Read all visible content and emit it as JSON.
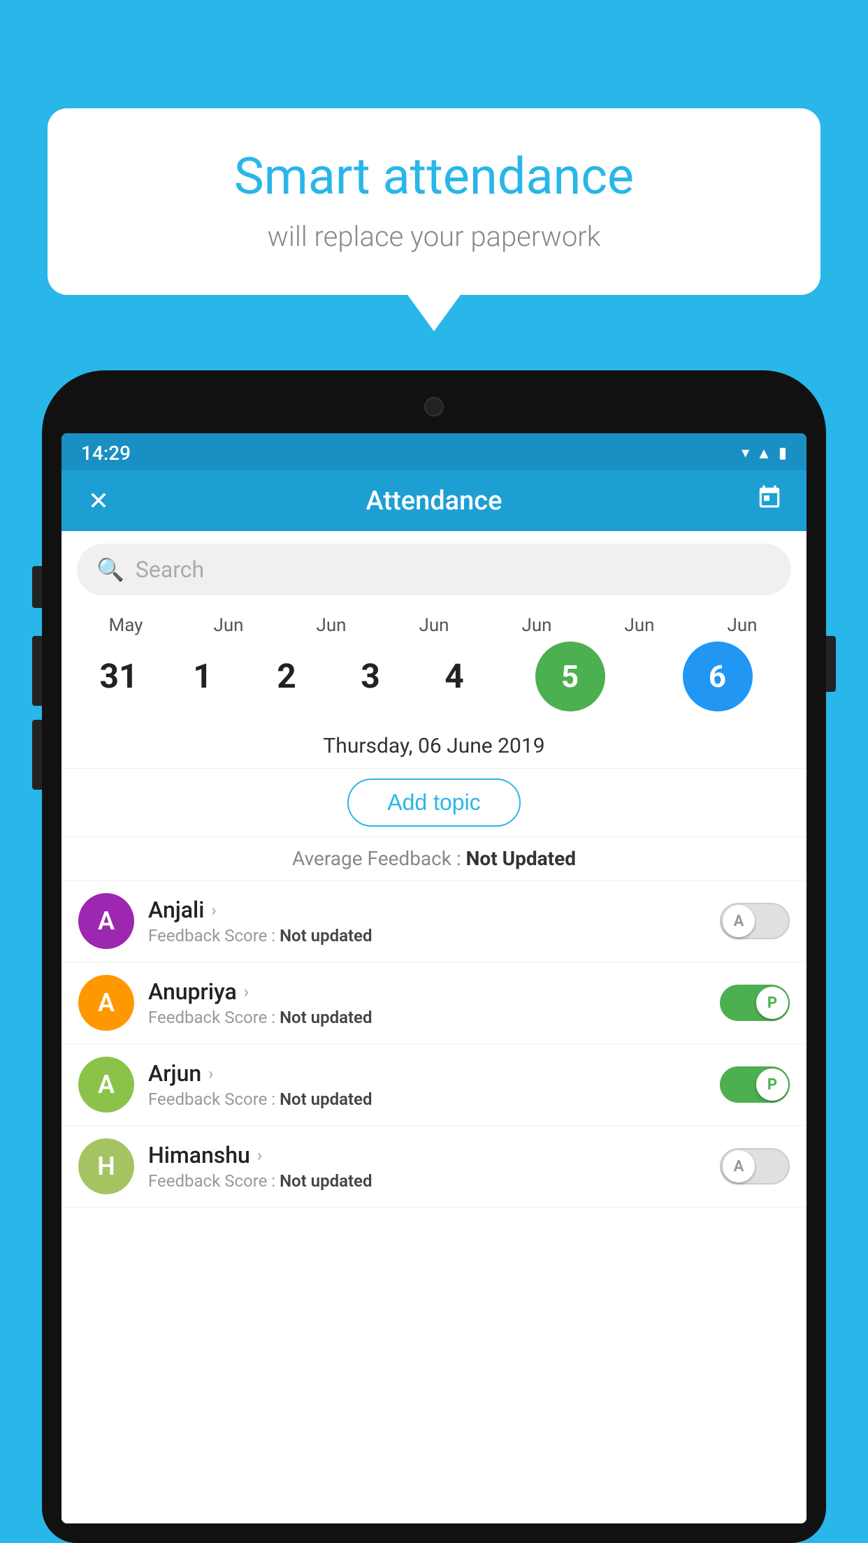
{
  "background_color": "#29b6e8",
  "bubble": {
    "title": "Smart attendance",
    "subtitle": "will replace your paperwork"
  },
  "phone": {
    "status_bar": {
      "time": "14:29",
      "icons": [
        "wifi",
        "signal",
        "battery"
      ]
    },
    "app_bar": {
      "close_label": "✕",
      "title": "Attendance",
      "calendar_icon": "📅"
    },
    "search": {
      "placeholder": "Search"
    },
    "calendar": {
      "months": [
        "May",
        "Jun",
        "Jun",
        "Jun",
        "Jun",
        "Jun",
        "Jun"
      ],
      "dates": [
        "31",
        "1",
        "2",
        "3",
        "4",
        "5",
        "6"
      ],
      "today_index": 5,
      "selected_index": 6
    },
    "selected_date": "Thursday, 06 June 2019",
    "add_topic_label": "Add topic",
    "avg_feedback_label": "Average Feedback : ",
    "avg_feedback_value": "Not Updated",
    "students": [
      {
        "name": "Anjali",
        "avatar_letter": "A",
        "avatar_color": "#9c27b0",
        "feedback_label": "Feedback Score : ",
        "feedback_value": "Not updated",
        "toggle_state": "off",
        "toggle_letter": "A"
      },
      {
        "name": "Anupriya",
        "avatar_letter": "A",
        "avatar_color": "#ff9800",
        "feedback_label": "Feedback Score : ",
        "feedback_value": "Not updated",
        "toggle_state": "on",
        "toggle_letter": "P"
      },
      {
        "name": "Arjun",
        "avatar_letter": "A",
        "avatar_color": "#8bc34a",
        "feedback_label": "Feedback Score : ",
        "feedback_value": "Not updated",
        "toggle_state": "on",
        "toggle_letter": "P"
      },
      {
        "name": "Himanshu",
        "avatar_letter": "H",
        "avatar_color": "#a5c461",
        "feedback_label": "Feedback Score : ",
        "feedback_value": "Not updated",
        "toggle_state": "off",
        "toggle_letter": "A"
      }
    ]
  }
}
